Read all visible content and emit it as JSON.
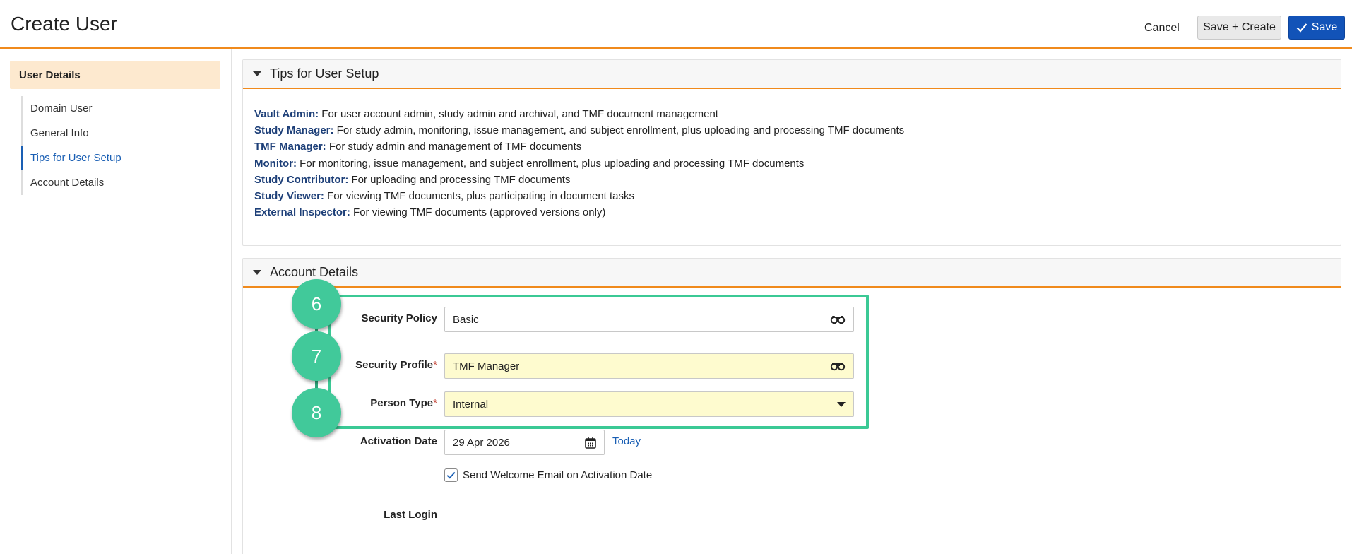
{
  "header": {
    "title": "Create User",
    "cancel_label": "Cancel",
    "save_create_label": "Save + Create",
    "save_label": "Save"
  },
  "sidebar": {
    "heading": "User Details",
    "items": [
      {
        "label": "Domain User",
        "active": false
      },
      {
        "label": "General Info",
        "active": false
      },
      {
        "label": "Tips for User Setup",
        "active": true
      },
      {
        "label": "Account Details",
        "active": false
      }
    ]
  },
  "tips": {
    "title": "Tips for User Setup",
    "lines": [
      {
        "role": "Vault Admin:",
        "text": " For user account admin, study admin and archival, and TMF document management"
      },
      {
        "role": "Study Manager:",
        "text": " For study admin, monitoring, issue management, and subject enrollment, plus uploading and processing TMF documents"
      },
      {
        "role": "TMF Manager:",
        "text": " For study admin and management of TMF documents"
      },
      {
        "role": "Monitor:",
        "text": " For monitoring, issue management, and subject enrollment, plus uploading and processing TMF documents"
      },
      {
        "role": "Study Contributor:",
        "text": " For uploading and processing TMF documents"
      },
      {
        "role": "Study Viewer:",
        "text": " For viewing TMF documents, plus participating in document tasks"
      },
      {
        "role": "External Inspector:",
        "text": " For viewing TMF documents (approved versions only)"
      }
    ]
  },
  "account": {
    "title": "Account Details",
    "security_policy_label": "Security Policy",
    "security_policy_value": "Basic",
    "security_profile_label": "Security Profile",
    "security_profile_value": "TMF Manager",
    "person_type_label": "Person Type",
    "person_type_value": "Internal",
    "required_marker": "*",
    "activation_date_label": "Activation Date",
    "activation_date_value": "29 Apr 2026",
    "today_label": "Today",
    "welcome_email_label": "Send Welcome Email on Activation Date",
    "welcome_email_checked": true,
    "last_login_label": "Last Login"
  },
  "callouts": [
    "6",
    "7",
    "8"
  ],
  "colors": {
    "accent_orange": "#f08a1c",
    "primary_blue": "#1253b8",
    "callout_green": "#41c99a",
    "required_field_bg": "#fefbcf",
    "nav_head_bg": "#fde9cf"
  }
}
